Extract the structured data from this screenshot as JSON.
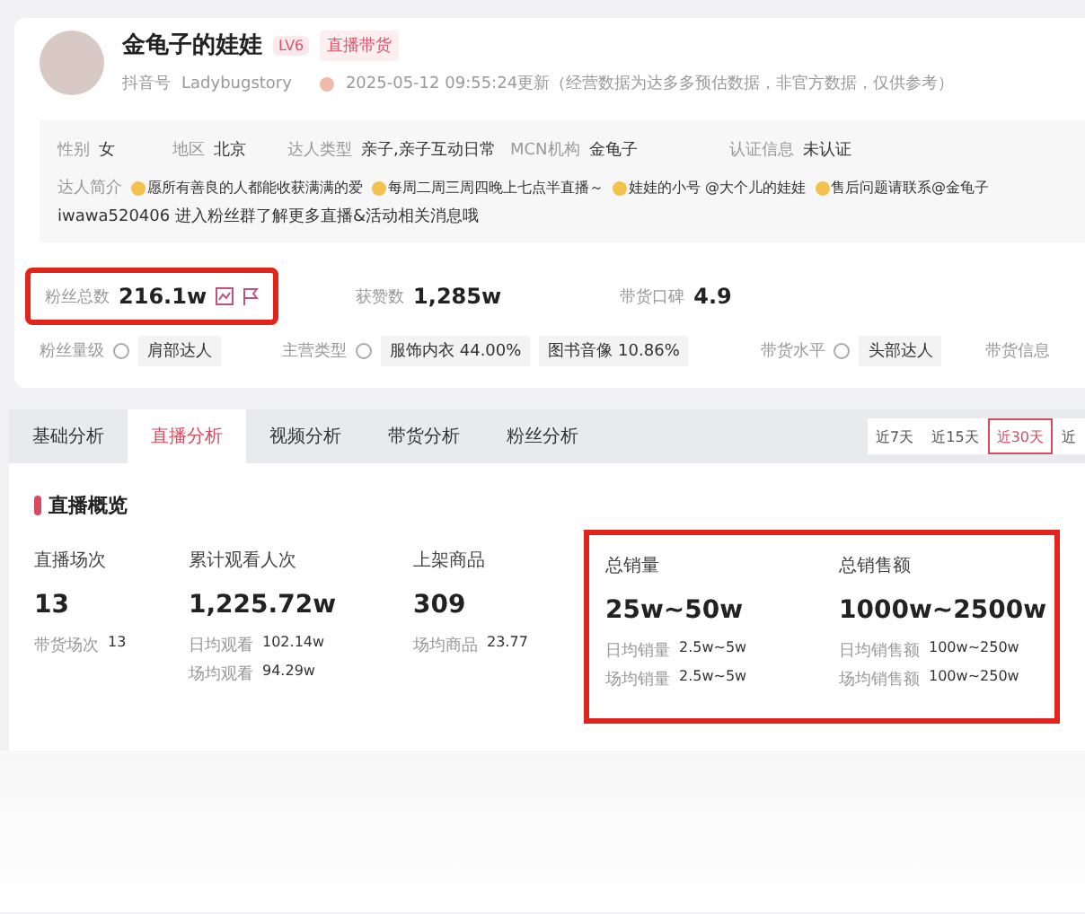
{
  "profile": {
    "name": "金龟子的娃娃",
    "level": "LV6",
    "tag": "直播带货",
    "account_label": "抖音号",
    "account": "Ladybugstory",
    "updated": "2025-05-12 09:55:24更新（经营数据为达多多预估数据，非官方数据，仅供参考）"
  },
  "info": [
    {
      "label": "性别",
      "value": "女"
    },
    {
      "label": "地区",
      "value": "北京"
    },
    {
      "label": "达人类型",
      "value": "亲子,亲子互动日常"
    },
    {
      "label": "MCN机构",
      "value": "金龟子"
    },
    {
      "label": "认证信息",
      "value": "未认证"
    }
  ],
  "bio": {
    "label": "达人简介",
    "segments": [
      "愿所有善良的人都能收获满满的爱",
      "每周二周三周四晚上七点半直播～",
      "娃娃的小号 @大个儿的娃娃",
      "售后问题请联系@金龟子"
    ],
    "line2": "iwawa520406 进入粉丝群了解更多直播&活动相关消息哦"
  },
  "stats": [
    {
      "label": "粉丝总数",
      "value": "216.1w",
      "highlighted": true
    },
    {
      "label": "获赞数",
      "value": "1,285w",
      "highlighted": false
    },
    {
      "label": "带货口碑",
      "value": "4.9",
      "highlighted": false
    }
  ],
  "levels": [
    {
      "label": "粉丝量级",
      "tags": [
        "肩部达人"
      ]
    },
    {
      "label": "主营类型",
      "tags": [
        "服饰内衣 44.00%",
        "图书音像 10.86%"
      ]
    },
    {
      "label": "带货水平",
      "tags": [
        "头部达人"
      ]
    },
    {
      "label": "带货信息"
    }
  ],
  "tabs": [
    {
      "label": "基础分析",
      "selected": false
    },
    {
      "label": "直播分析",
      "selected": true
    },
    {
      "label": "视频分析",
      "selected": false
    },
    {
      "label": "带货分析",
      "selected": false
    },
    {
      "label": "粉丝分析",
      "selected": false
    }
  ],
  "ranges": [
    {
      "label": "近7天",
      "selected": false
    },
    {
      "label": "近15天",
      "selected": false
    },
    {
      "label": "近30天",
      "selected": true
    },
    {
      "label": "近",
      "selected": false
    }
  ],
  "section_title": "直播概览",
  "metrics": [
    {
      "label": "直播场次",
      "value": "13",
      "highlighted": false,
      "subs": [
        {
          "label": "带货场次",
          "value": "13"
        }
      ]
    },
    {
      "label": "累计观看人次",
      "value": "1,225.72w",
      "highlighted": false,
      "subs": [
        {
          "label": "日均观看",
          "value": "102.14w"
        },
        {
          "label": "场均观看",
          "value": "94.29w"
        }
      ]
    },
    {
      "label": "上架商品",
      "value": "309",
      "highlighted": false,
      "subs": [
        {
          "label": "场均商品",
          "value": "23.77"
        }
      ]
    },
    {
      "label": "总销量",
      "value": "25w~50w",
      "highlighted": true,
      "subs": [
        {
          "label": "日均销量",
          "value": "2.5w~5w"
        },
        {
          "label": "场均销量",
          "value": "2.5w~5w"
        }
      ]
    },
    {
      "label": "总销售额",
      "value": "1000w~2500w",
      "highlighted": true,
      "subs": [
        {
          "label": "日均销售额",
          "value": "100w~250w"
        },
        {
          "label": "场均销售额",
          "value": "100w~250w"
        }
      ]
    }
  ]
}
